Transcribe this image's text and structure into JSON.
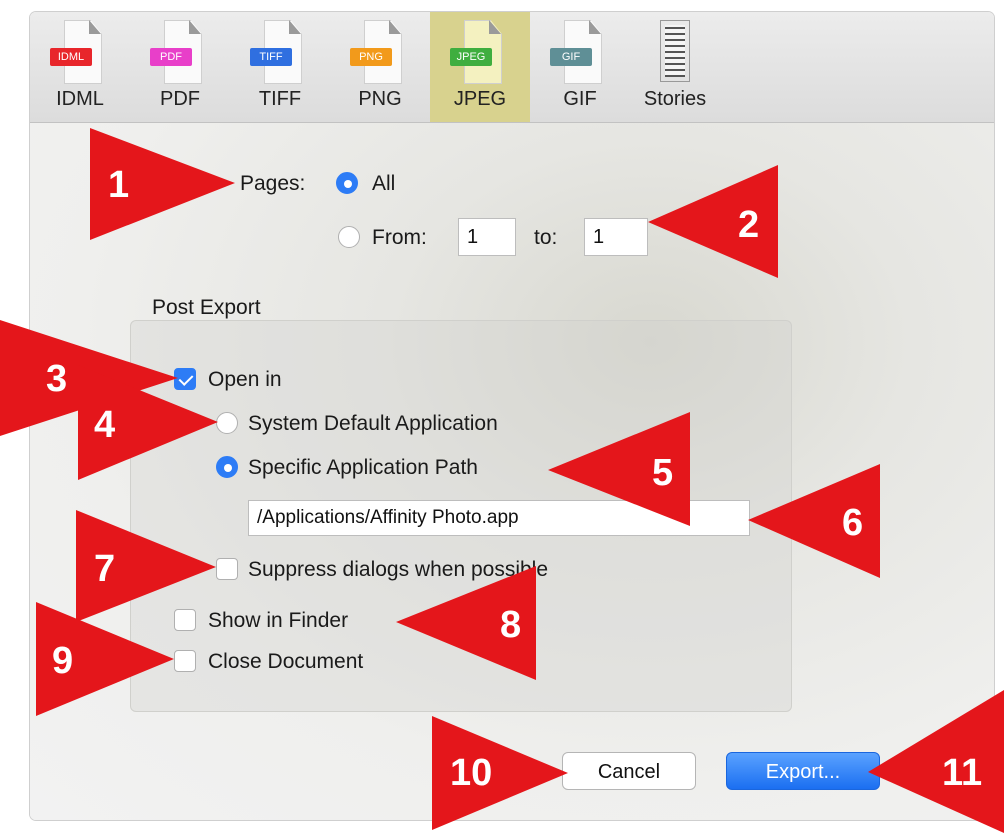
{
  "toolbar": {
    "items": [
      {
        "label": "IDML",
        "tag": "IDML",
        "color": "#e8262b"
      },
      {
        "label": "PDF",
        "tag": "PDF",
        "color": "#e83fc9"
      },
      {
        "label": "TIFF",
        "tag": "TIFF",
        "color": "#2f6fe0"
      },
      {
        "label": "PNG",
        "tag": "PNG",
        "color": "#f29a1b"
      },
      {
        "label": "JPEG",
        "tag": "JPEG",
        "color": "#3fae3f",
        "selected": true
      },
      {
        "label": "GIF",
        "tag": "GIF",
        "color": "#5f8f96"
      },
      {
        "label": "Stories"
      }
    ]
  },
  "pages": {
    "label": "Pages:",
    "all_label": "All",
    "from_label": "From:",
    "from_value": "1",
    "to_label": "to:",
    "to_value": "1"
  },
  "post_export": {
    "title": "Post Export",
    "open_in_label": "Open in",
    "open_in_checked": true,
    "system_default_label": "System Default Application",
    "specific_path_label": "Specific Application Path",
    "path_value": "/Applications/Affinity Photo.app",
    "suppress_label": "Suppress dialogs when possible",
    "show_in_finder_label": "Show in Finder",
    "close_document_label": "Close Document"
  },
  "buttons": {
    "cancel": "Cancel",
    "export": "Export..."
  },
  "annotations": {
    "color": "#e4161b",
    "labels": [
      "1",
      "2",
      "3",
      "4",
      "5",
      "6",
      "7",
      "8",
      "9",
      "10",
      "11"
    ]
  }
}
